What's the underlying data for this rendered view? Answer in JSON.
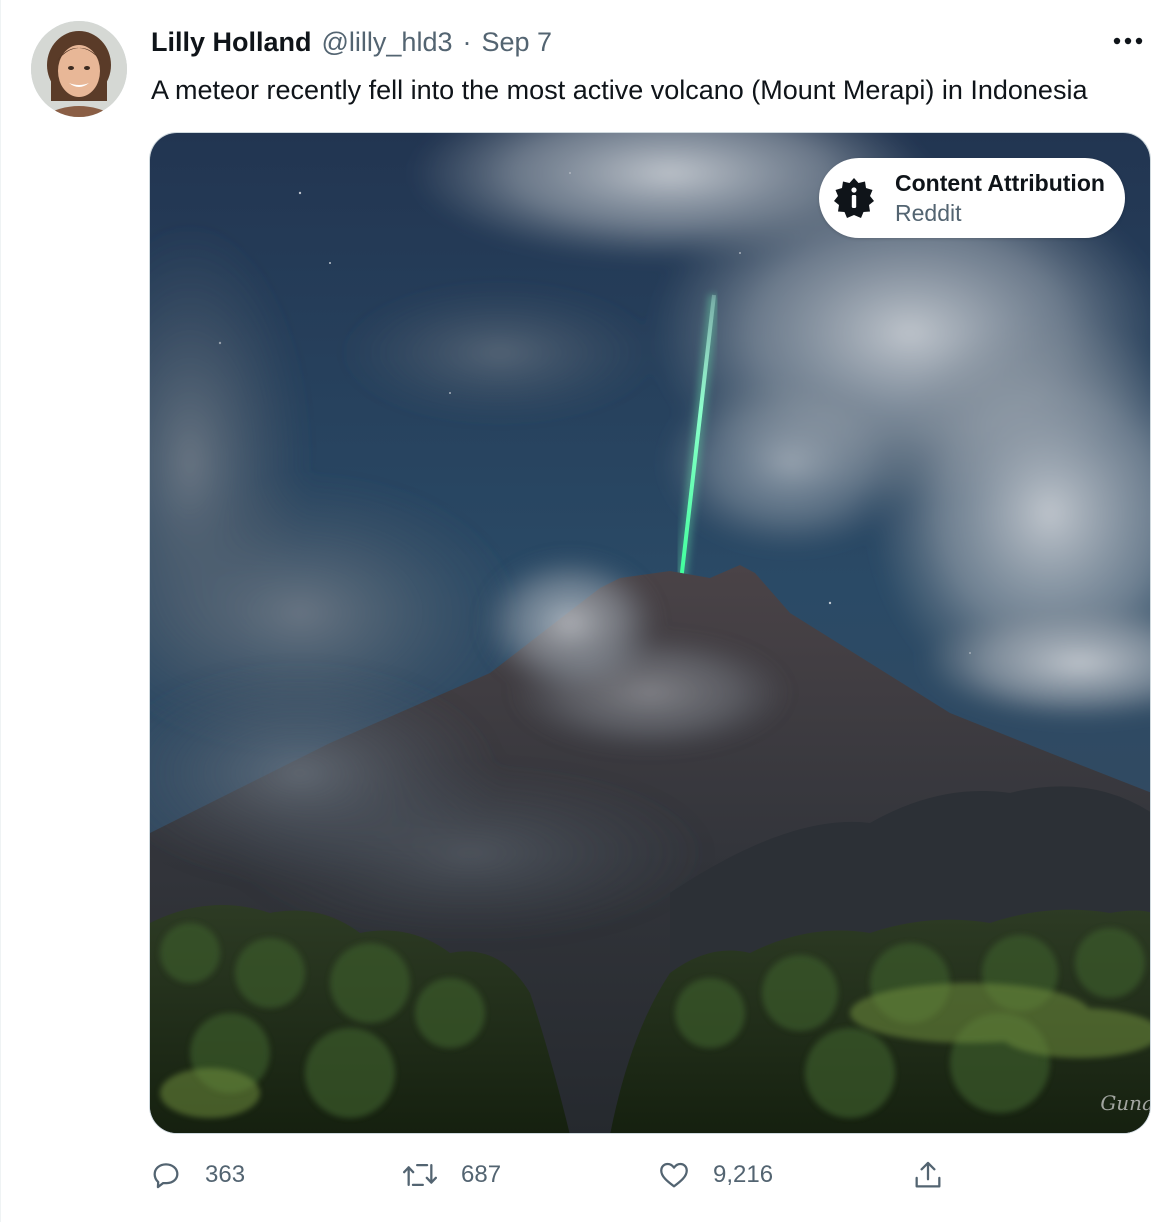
{
  "author": {
    "display_name": "Lilly Holland",
    "handle": "@lilly_hld3",
    "separator": "·",
    "date": "Sep 7"
  },
  "tweet": {
    "text": "A meteor recently fell into the most active volcano (Mount Merapi) in Indonesia"
  },
  "media": {
    "attribution_title": "Content Attribution",
    "attribution_source": "Reddit",
    "watermark": "Guna"
  },
  "actions": {
    "reply_count": "363",
    "retweet_count": "687",
    "like_count": "9,216"
  },
  "icons": {
    "more": "more-horizontal-icon",
    "reply": "reply-icon",
    "retweet": "retweet-icon",
    "like": "heart-icon",
    "share": "share-icon",
    "info": "info-badge-icon"
  },
  "colors": {
    "text_primary": "#0f1419",
    "text_secondary": "#536471",
    "meteor": "#7dffb0",
    "sky": "#1f3554"
  }
}
